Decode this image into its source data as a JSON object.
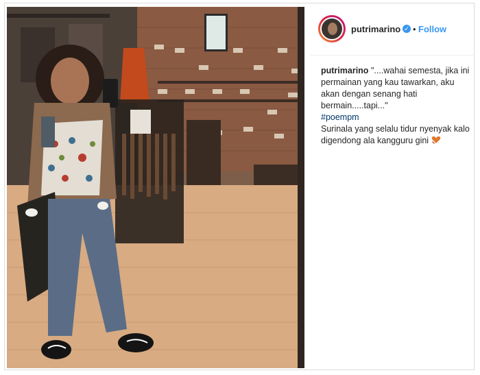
{
  "post": {
    "username": "putrimarino",
    "verified_icon": "verified-badge-icon",
    "separator": "•",
    "follow_label": "Follow",
    "caption": {
      "username": "putrimarino",
      "text": "\"....wahai semesta, jika ini permainan yang kau tawarkan, aku akan dengan senang hati bermain.....tapi...\"",
      "hashtag": "#poempm",
      "text2": "Surinala yang selalu tidur nyenyak kalo digendong ala kangguru gini",
      "emoji": "hands-heart-emoji"
    }
  },
  "colors": {
    "link": "#3897f0",
    "hashtag": "#003569",
    "text": "#262626",
    "border": "#dbdbdb"
  }
}
